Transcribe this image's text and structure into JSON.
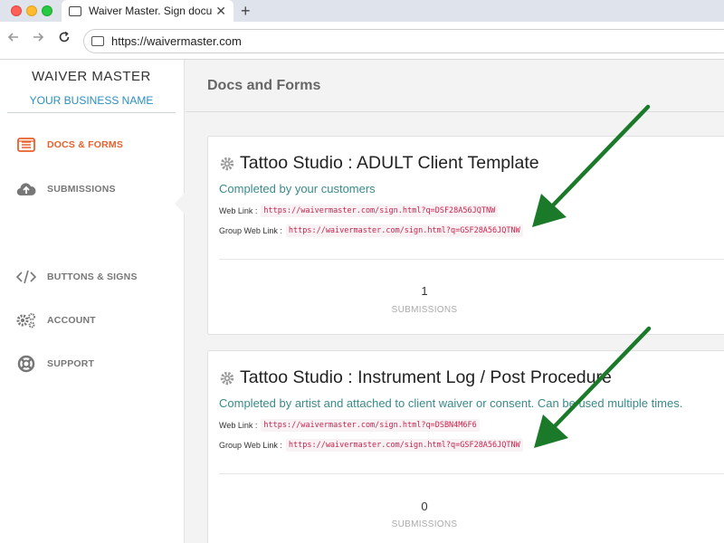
{
  "browser": {
    "tab_title": "Waiver Master. Sign documents",
    "url": "https://waivermaster.com",
    "new_tab_glyph": "+",
    "close_glyph": "✕"
  },
  "sidebar": {
    "brand": "WAIVER MASTER",
    "business_name": "YOUR BUSINESS NAME",
    "items": [
      {
        "label": "DOCS & FORMS",
        "icon": "list-icon",
        "active": true
      },
      {
        "label": "SUBMISSIONS",
        "icon": "cloud-upload-icon",
        "active": false
      },
      {
        "label": "BUTTONS & SIGNS",
        "icon": "code-icon",
        "active": false
      },
      {
        "label": "ACCOUNT",
        "icon": "gears-icon",
        "active": false
      },
      {
        "label": "SUPPORT",
        "icon": "lifebuoy-icon",
        "active": false
      }
    ]
  },
  "main": {
    "title": "Docs and Forms",
    "web_link_label": "Web Link :",
    "group_link_label": "Group Web Link :",
    "submissions_label": "SUBMISSIONS",
    "forms": [
      {
        "title": "Tattoo Studio : ADULT Client Template",
        "description": "Completed by your customers",
        "web_link": "https://waivermaster.com/sign.html?q=DSF28A56JQTNW",
        "group_link": "https://waivermaster.com/sign.html?q=GSF28A56JQTNW",
        "submissions": "1"
      },
      {
        "title": "Tattoo Studio : Instrument Log / Post Procedure",
        "description": "Completed by artist and attached to client waiver or consent. Can be used multiple times.",
        "web_link": "https://waivermaster.com/sign.html?q=DSBN4M6F6",
        "group_link": "https://waivermaster.com/sign.html?q=GSF28A56JQTNW",
        "submissions": "0"
      }
    ]
  },
  "colors": {
    "accent": "#e8602c",
    "link_code": "#c7254e",
    "description": "#3a8a8a",
    "arrow": "#1a7a2a"
  }
}
